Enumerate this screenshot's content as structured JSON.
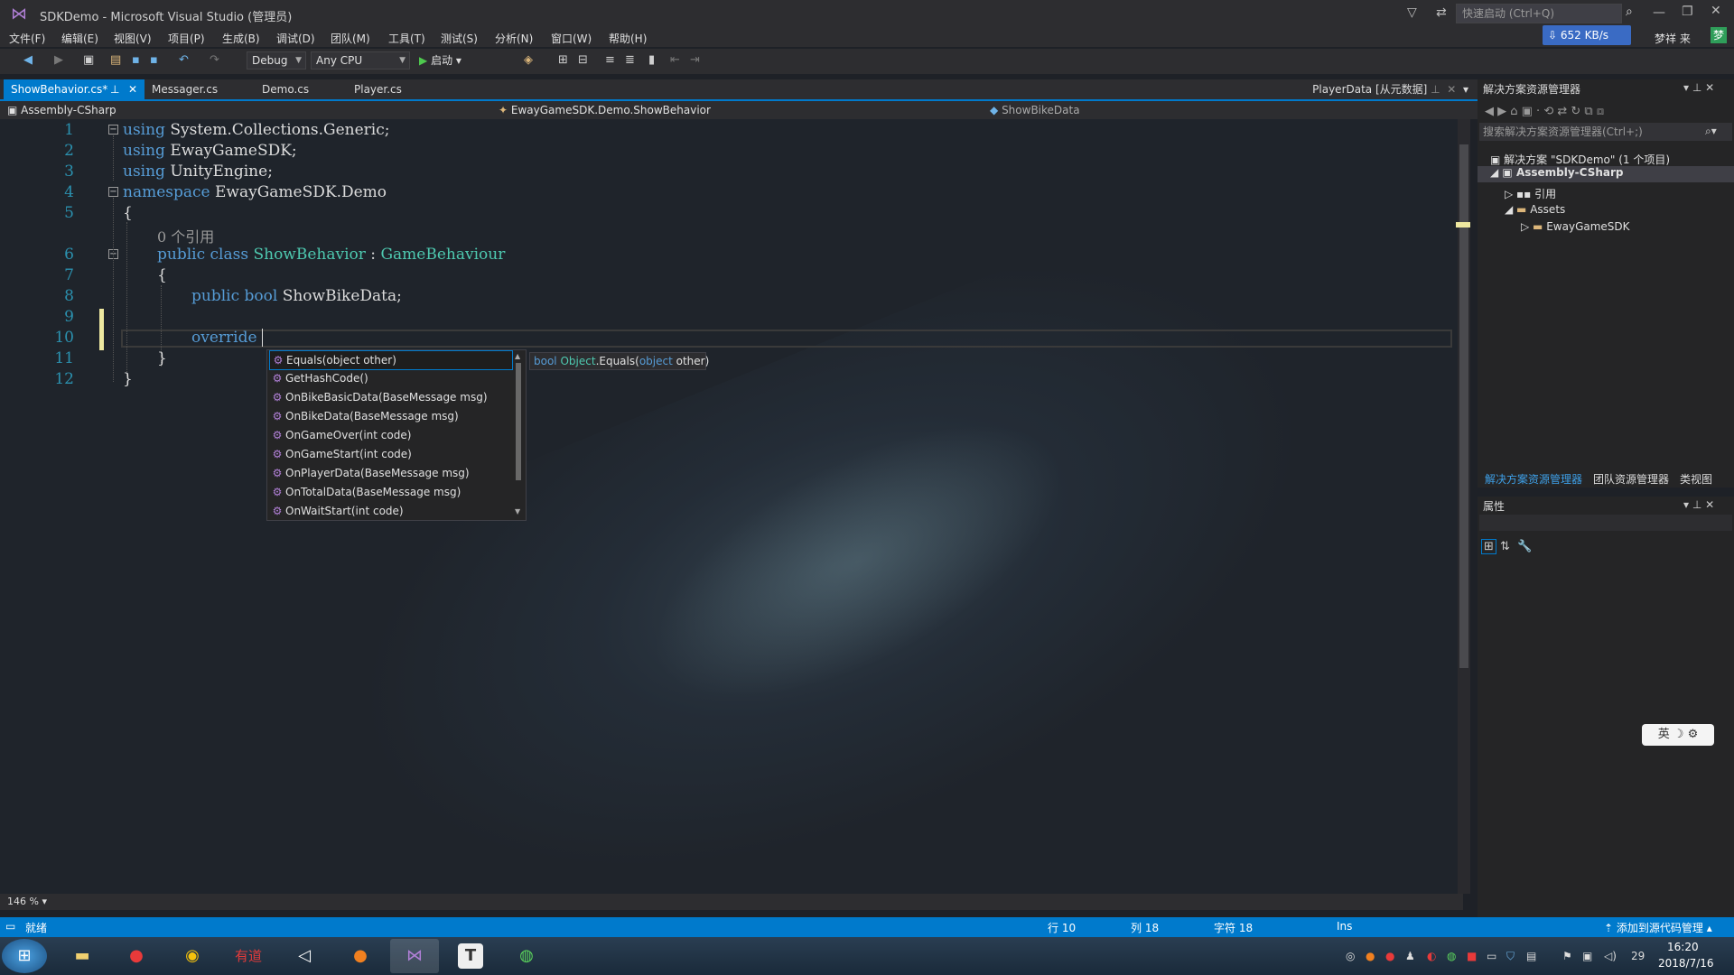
{
  "window": {
    "title": "SDKDemo - Microsoft Visual Studio (管理员)",
    "quick_launch_placeholder": "快速启动 (Ctrl+Q)",
    "network_speed": "652 KB/s",
    "user_name": "梦祥 来",
    "user_avatar_text": "梦"
  },
  "menu": [
    "文件(F)",
    "编辑(E)",
    "视图(V)",
    "项目(P)",
    "生成(B)",
    "调试(D)",
    "团队(M)",
    "工具(T)",
    "测试(S)",
    "分析(N)",
    "窗口(W)",
    "帮助(H)"
  ],
  "toolbar": {
    "config": "Debug",
    "platform": "Any CPU",
    "start_label": "启动"
  },
  "tabs": [
    {
      "label": "ShowBehavior.cs*",
      "active": true
    },
    {
      "label": "Messager.cs",
      "active": false
    },
    {
      "label": "Demo.cs",
      "active": false
    },
    {
      "label": "Player.cs",
      "active": false
    }
  ],
  "tab_right_label": "PlayerData [从元数据]",
  "navbar": {
    "project": "Assembly-CSharp",
    "type": "EwayGameSDK.Demo.ShowBehavior",
    "member": "ShowBikeData"
  },
  "code": {
    "line_numbers": [
      "1",
      "2",
      "3",
      "4",
      "5",
      "6",
      "7",
      "8",
      "9",
      "10",
      "11",
      "12"
    ],
    "l1_kw": "using",
    "l1_rest": " System.Collections.Generic;",
    "l2_kw": "using",
    "l2_rest": " EwayGameSDK;",
    "l3_kw": "using",
    "l3_rest": " UnityEngine;",
    "l4_kw": "namespace",
    "l4_rest": " EwayGameSDK.Demo",
    "l5": "{",
    "codelens": "0 个引用",
    "l6_kw": "public class",
    "l6_type": "ShowBehavior",
    "l6_colon": " : ",
    "l6_base": "GameBehaviour",
    "l7": "{",
    "l8_kw": "public bool",
    "l8_rest": " ShowBikeData;",
    "l10_kw": "override",
    "l11": "}",
    "l12": "}"
  },
  "completion": {
    "items": [
      "Equals(object other)",
      "GetHashCode()",
      "OnBikeBasicData(BaseMessage msg)",
      "OnBikeData(BaseMessage msg)",
      "OnGameOver(int code)",
      "OnGameStart(int code)",
      "OnPlayerData(BaseMessage msg)",
      "OnTotalData(BaseMessage msg)",
      "OnWaitStart(int code)"
    ],
    "tooltip_kw1": "bool",
    "tooltip_type": "Object",
    "tooltip_method": ".Equals(",
    "tooltip_kw2": "object",
    "tooltip_end": " other)"
  },
  "zoom": "146 %",
  "solution_explorer": {
    "title": "解决方案资源管理器",
    "search_placeholder": "搜索解决方案资源管理器(Ctrl+;)",
    "solution": "解决方案 \"SDKDemo\" (1 个项目)",
    "project": "Assembly-CSharp",
    "references": "引用",
    "assets": "Assets",
    "folder": "EwayGameSDK",
    "bottom_tabs": [
      "解决方案资源管理器",
      "团队资源管理器",
      "类视图"
    ]
  },
  "properties": {
    "title": "属性"
  },
  "ime": "英 ☽ ⚙",
  "status": {
    "ready": "就绪",
    "line": "行 10",
    "col": "列 18",
    "char": "字符 18",
    "ins": "Ins",
    "source_control": "添加到源代码管理"
  },
  "taskbar": {
    "time": "16:20",
    "date": "2018/7/16",
    "apps": [
      "start",
      "explorer",
      "weibo",
      "chrome",
      "youdao",
      "unity",
      "jack-o-lantern",
      "visual-studio",
      "typora",
      "wechat"
    ],
    "youdao_label": "有道",
    "typora_label": "T",
    "tray_num": "29"
  },
  "colors": {
    "accent": "#007acc",
    "keyword": "#569cd6",
    "type": "#4ec9b0",
    "line_number": "#2b91af"
  }
}
